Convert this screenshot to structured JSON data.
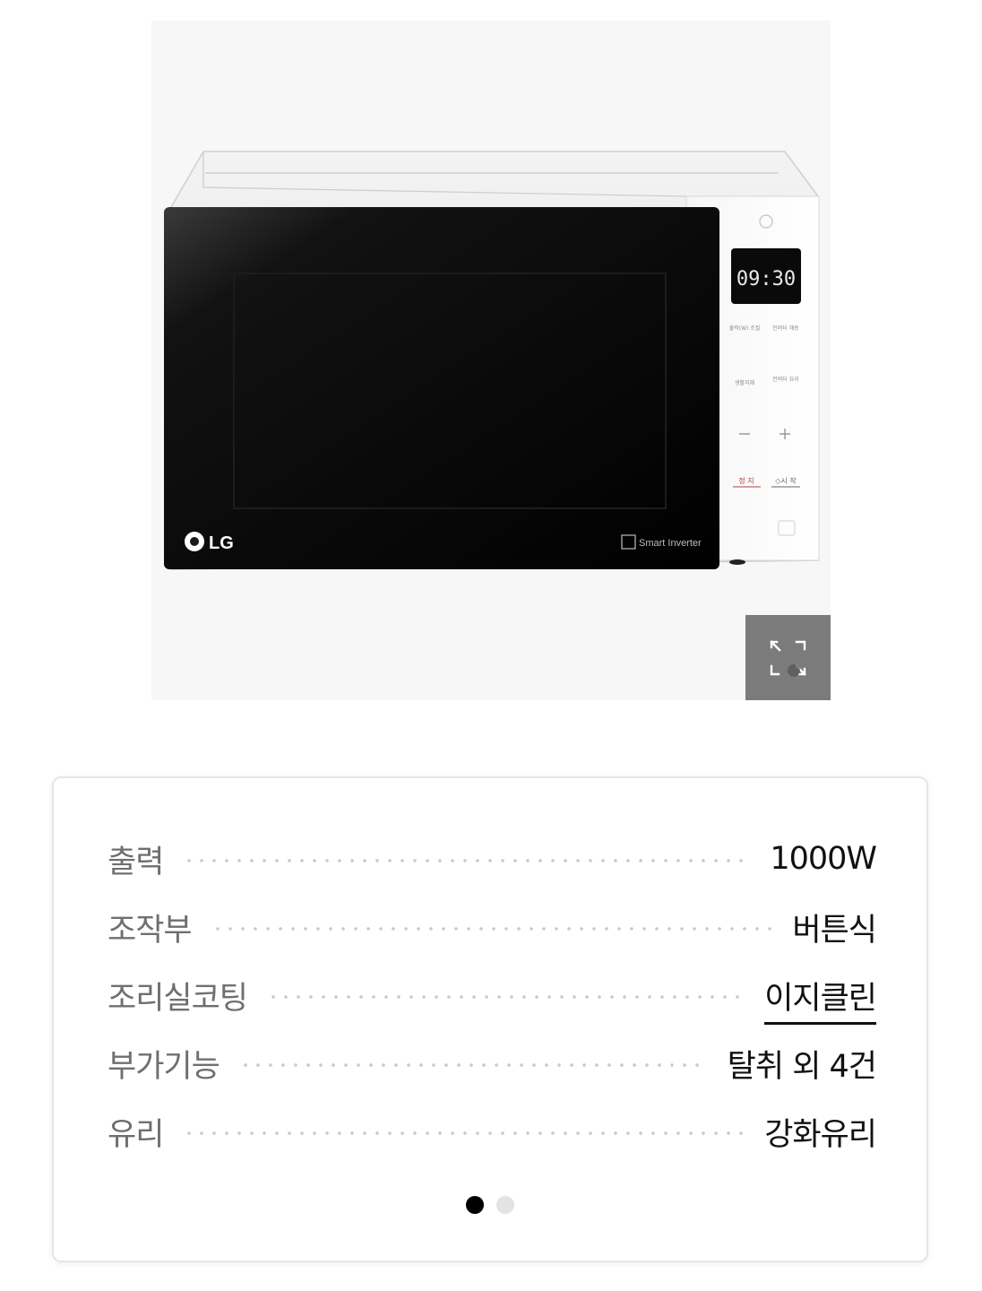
{
  "product_image": {
    "brand_logo": "LG",
    "badge_text": "Smart Inverter",
    "display_time": "09:30",
    "panel_labels": [
      "출력(W) 조절",
      "인버터 해동",
      "생활지혜",
      "인버터 요리",
      "정 지",
      "◇시 작"
    ],
    "expand_icon": "expand-icon"
  },
  "specs": [
    {
      "label": "출력",
      "value": "1000W",
      "link": false
    },
    {
      "label": "조작부",
      "value": "버튼식",
      "link": false
    },
    {
      "label": "조리실코팅",
      "value": "이지클린",
      "link": true
    },
    {
      "label": "부가기능",
      "value": "탈취 외 4건",
      "link": false
    },
    {
      "label": "유리",
      "value": "강화유리",
      "link": false
    }
  ],
  "pager": {
    "count": 2,
    "active": 0
  },
  "colors": {
    "label": "#6f6f6f",
    "value": "#111111",
    "expand_button": "#7b7b7b",
    "pager_active": "#000000",
    "pager_inactive": "#e3e3e3"
  }
}
